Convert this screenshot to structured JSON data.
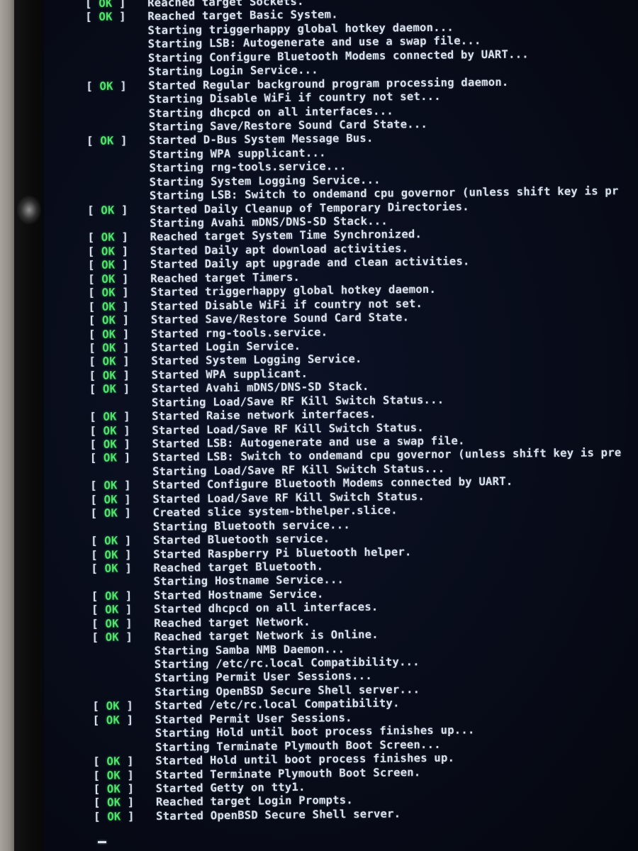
{
  "ok_label": "OK",
  "lines": [
    {
      "status": "ok",
      "text": "Reached target Sockets."
    },
    {
      "status": "ok",
      "text": "Reached target Basic System."
    },
    {
      "status": "",
      "text": "Starting triggerhappy global hotkey daemon..."
    },
    {
      "status": "",
      "text": "Starting LSB: Autogenerate and use a swap file..."
    },
    {
      "status": "",
      "text": "Starting Configure Bluetooth Modems connected by UART..."
    },
    {
      "status": "",
      "text": "Starting Login Service..."
    },
    {
      "status": "ok",
      "text": "Started Regular background program processing daemon."
    },
    {
      "status": "",
      "text": "Starting Disable WiFi if country not set..."
    },
    {
      "status": "",
      "text": "Starting dhcpcd on all interfaces..."
    },
    {
      "status": "",
      "text": "Starting Save/Restore Sound Card State..."
    },
    {
      "status": "ok",
      "text": "Started D-Bus System Message Bus."
    },
    {
      "status": "",
      "text": "Starting WPA supplicant..."
    },
    {
      "status": "",
      "text": "Starting rng-tools.service..."
    },
    {
      "status": "",
      "text": "Starting System Logging Service..."
    },
    {
      "status": "",
      "text": "Starting LSB: Switch to ondemand cpu governor (unless shift key is pr"
    },
    {
      "status": "ok",
      "text": "Started Daily Cleanup of Temporary Directories."
    },
    {
      "status": "",
      "text": "Starting Avahi mDNS/DNS-SD Stack..."
    },
    {
      "status": "ok",
      "text": "Reached target System Time Synchronized."
    },
    {
      "status": "ok",
      "text": "Started Daily apt download activities."
    },
    {
      "status": "ok",
      "text": "Started Daily apt upgrade and clean activities."
    },
    {
      "status": "ok",
      "text": "Reached target Timers."
    },
    {
      "status": "ok",
      "text": "Started triggerhappy global hotkey daemon."
    },
    {
      "status": "ok",
      "text": "Started Disable WiFi if country not set."
    },
    {
      "status": "ok",
      "text": "Started Save/Restore Sound Card State."
    },
    {
      "status": "ok",
      "text": "Started rng-tools.service."
    },
    {
      "status": "ok",
      "text": "Started Login Service."
    },
    {
      "status": "ok",
      "text": "Started System Logging Service."
    },
    {
      "status": "ok",
      "text": "Started WPA supplicant."
    },
    {
      "status": "ok",
      "text": "Started Avahi mDNS/DNS-SD Stack."
    },
    {
      "status": "",
      "text": "Starting Load/Save RF Kill Switch Status..."
    },
    {
      "status": "ok",
      "text": "Started Raise network interfaces."
    },
    {
      "status": "ok",
      "text": "Started Load/Save RF Kill Switch Status."
    },
    {
      "status": "ok",
      "text": "Started LSB: Autogenerate and use a swap file."
    },
    {
      "status": "ok",
      "text": "Started LSB: Switch to ondemand cpu governor (unless shift key is pre"
    },
    {
      "status": "",
      "text": "Starting Load/Save RF Kill Switch Status..."
    },
    {
      "status": "ok",
      "text": "Started Configure Bluetooth Modems connected by UART."
    },
    {
      "status": "ok",
      "text": "Started Load/Save RF Kill Switch Status."
    },
    {
      "status": "ok",
      "text": "Created slice system-bthelper.slice."
    },
    {
      "status": "",
      "text": "Starting Bluetooth service..."
    },
    {
      "status": "ok",
      "text": "Started Bluetooth service."
    },
    {
      "status": "ok",
      "text": "Started Raspberry Pi bluetooth helper."
    },
    {
      "status": "ok",
      "text": "Reached target Bluetooth."
    },
    {
      "status": "",
      "text": "Starting Hostname Service..."
    },
    {
      "status": "ok",
      "text": "Started Hostname Service."
    },
    {
      "status": "ok",
      "text": "Started dhcpcd on all interfaces."
    },
    {
      "status": "ok",
      "text": "Reached target Network."
    },
    {
      "status": "ok",
      "text": "Reached target Network is Online."
    },
    {
      "status": "",
      "text": "Starting Samba NMB Daemon..."
    },
    {
      "status": "",
      "text": "Starting /etc/rc.local Compatibility..."
    },
    {
      "status": "",
      "text": "Starting Permit User Sessions..."
    },
    {
      "status": "",
      "text": "Starting OpenBSD Secure Shell server..."
    },
    {
      "status": "ok",
      "text": "Started /etc/rc.local Compatibility."
    },
    {
      "status": "ok",
      "text": "Started Permit User Sessions."
    },
    {
      "status": "",
      "text": "Starting Hold until boot process finishes up..."
    },
    {
      "status": "",
      "text": "Starting Terminate Plymouth Boot Screen..."
    },
    {
      "status": "ok",
      "text": "Started Hold until boot process finishes up."
    },
    {
      "status": "ok",
      "text": "Started Terminate Plymouth Boot Screen."
    },
    {
      "status": "ok",
      "text": "Started Getty on tty1."
    },
    {
      "status": "ok",
      "text": "Reached target Login Prompts."
    },
    {
      "status": "ok",
      "text": "Started OpenBSD Secure Shell server."
    }
  ],
  "colors": {
    "ok_green": "#4fe36a",
    "text": "#d9e1ea",
    "screen_bg": "#080c1a"
  }
}
